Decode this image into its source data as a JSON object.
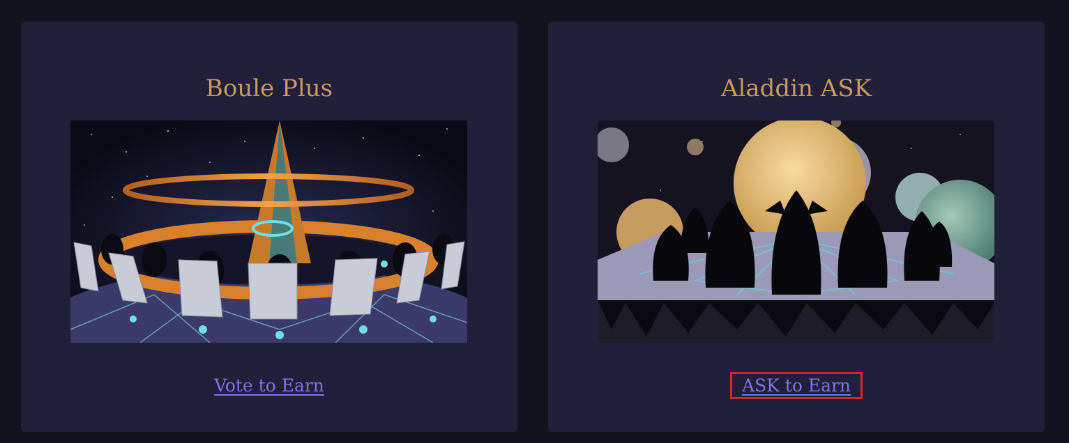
{
  "cards": [
    {
      "title": "Boule Plus",
      "image_alt": "Robed figures seated in a circle around a glowing golden obelisk under a starry sky",
      "link_label": "Vote to Earn",
      "highlighted": false
    },
    {
      "title": "Aladdin ASK",
      "image_alt": "Silhouetted robed figures gathered on a floating stone platform before large planets",
      "link_label": "ASK to Earn",
      "highlighted": true
    }
  ],
  "colors": {
    "page_bg": "#13121f",
    "card_bg": "#221f3a",
    "title": "#c99a5b",
    "link": "#7b75ee",
    "highlight_border": "#d7232e"
  },
  "icons": [
    "obelisk-artwork",
    "planets-artwork"
  ]
}
